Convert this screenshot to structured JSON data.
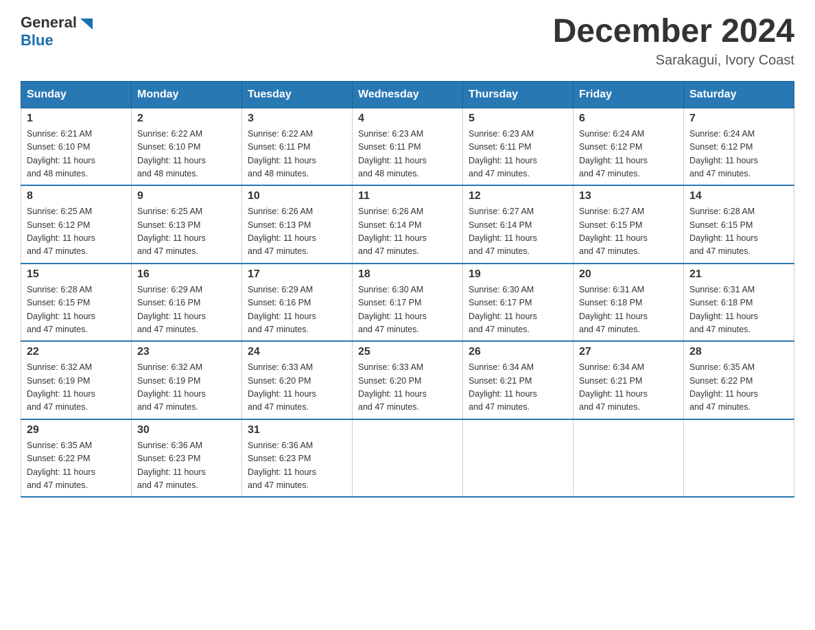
{
  "header": {
    "logo_general": "General",
    "logo_blue": "Blue",
    "month_title": "December 2024",
    "location": "Sarakagui, Ivory Coast"
  },
  "days_of_week": [
    "Sunday",
    "Monday",
    "Tuesday",
    "Wednesday",
    "Thursday",
    "Friday",
    "Saturday"
  ],
  "weeks": [
    [
      {
        "day": "1",
        "sunrise": "6:21 AM",
        "sunset": "6:10 PM",
        "daylight": "11 hours and 48 minutes."
      },
      {
        "day": "2",
        "sunrise": "6:22 AM",
        "sunset": "6:10 PM",
        "daylight": "11 hours and 48 minutes."
      },
      {
        "day": "3",
        "sunrise": "6:22 AM",
        "sunset": "6:11 PM",
        "daylight": "11 hours and 48 minutes."
      },
      {
        "day": "4",
        "sunrise": "6:23 AM",
        "sunset": "6:11 PM",
        "daylight": "11 hours and 48 minutes."
      },
      {
        "day": "5",
        "sunrise": "6:23 AM",
        "sunset": "6:11 PM",
        "daylight": "11 hours and 47 minutes."
      },
      {
        "day": "6",
        "sunrise": "6:24 AM",
        "sunset": "6:12 PM",
        "daylight": "11 hours and 47 minutes."
      },
      {
        "day": "7",
        "sunrise": "6:24 AM",
        "sunset": "6:12 PM",
        "daylight": "11 hours and 47 minutes."
      }
    ],
    [
      {
        "day": "8",
        "sunrise": "6:25 AM",
        "sunset": "6:12 PM",
        "daylight": "11 hours and 47 minutes."
      },
      {
        "day": "9",
        "sunrise": "6:25 AM",
        "sunset": "6:13 PM",
        "daylight": "11 hours and 47 minutes."
      },
      {
        "day": "10",
        "sunrise": "6:26 AM",
        "sunset": "6:13 PM",
        "daylight": "11 hours and 47 minutes."
      },
      {
        "day": "11",
        "sunrise": "6:26 AM",
        "sunset": "6:14 PM",
        "daylight": "11 hours and 47 minutes."
      },
      {
        "day": "12",
        "sunrise": "6:27 AM",
        "sunset": "6:14 PM",
        "daylight": "11 hours and 47 minutes."
      },
      {
        "day": "13",
        "sunrise": "6:27 AM",
        "sunset": "6:15 PM",
        "daylight": "11 hours and 47 minutes."
      },
      {
        "day": "14",
        "sunrise": "6:28 AM",
        "sunset": "6:15 PM",
        "daylight": "11 hours and 47 minutes."
      }
    ],
    [
      {
        "day": "15",
        "sunrise": "6:28 AM",
        "sunset": "6:15 PM",
        "daylight": "11 hours and 47 minutes."
      },
      {
        "day": "16",
        "sunrise": "6:29 AM",
        "sunset": "6:16 PM",
        "daylight": "11 hours and 47 minutes."
      },
      {
        "day": "17",
        "sunrise": "6:29 AM",
        "sunset": "6:16 PM",
        "daylight": "11 hours and 47 minutes."
      },
      {
        "day": "18",
        "sunrise": "6:30 AM",
        "sunset": "6:17 PM",
        "daylight": "11 hours and 47 minutes."
      },
      {
        "day": "19",
        "sunrise": "6:30 AM",
        "sunset": "6:17 PM",
        "daylight": "11 hours and 47 minutes."
      },
      {
        "day": "20",
        "sunrise": "6:31 AM",
        "sunset": "6:18 PM",
        "daylight": "11 hours and 47 minutes."
      },
      {
        "day": "21",
        "sunrise": "6:31 AM",
        "sunset": "6:18 PM",
        "daylight": "11 hours and 47 minutes."
      }
    ],
    [
      {
        "day": "22",
        "sunrise": "6:32 AM",
        "sunset": "6:19 PM",
        "daylight": "11 hours and 47 minutes."
      },
      {
        "day": "23",
        "sunrise": "6:32 AM",
        "sunset": "6:19 PM",
        "daylight": "11 hours and 47 minutes."
      },
      {
        "day": "24",
        "sunrise": "6:33 AM",
        "sunset": "6:20 PM",
        "daylight": "11 hours and 47 minutes."
      },
      {
        "day": "25",
        "sunrise": "6:33 AM",
        "sunset": "6:20 PM",
        "daylight": "11 hours and 47 minutes."
      },
      {
        "day": "26",
        "sunrise": "6:34 AM",
        "sunset": "6:21 PM",
        "daylight": "11 hours and 47 minutes."
      },
      {
        "day": "27",
        "sunrise": "6:34 AM",
        "sunset": "6:21 PM",
        "daylight": "11 hours and 47 minutes."
      },
      {
        "day": "28",
        "sunrise": "6:35 AM",
        "sunset": "6:22 PM",
        "daylight": "11 hours and 47 minutes."
      }
    ],
    [
      {
        "day": "29",
        "sunrise": "6:35 AM",
        "sunset": "6:22 PM",
        "daylight": "11 hours and 47 minutes."
      },
      {
        "day": "30",
        "sunrise": "6:36 AM",
        "sunset": "6:23 PM",
        "daylight": "11 hours and 47 minutes."
      },
      {
        "day": "31",
        "sunrise": "6:36 AM",
        "sunset": "6:23 PM",
        "daylight": "11 hours and 47 minutes."
      },
      null,
      null,
      null,
      null
    ]
  ],
  "labels": {
    "sunrise": "Sunrise:",
    "sunset": "Sunset:",
    "daylight": "Daylight:"
  }
}
